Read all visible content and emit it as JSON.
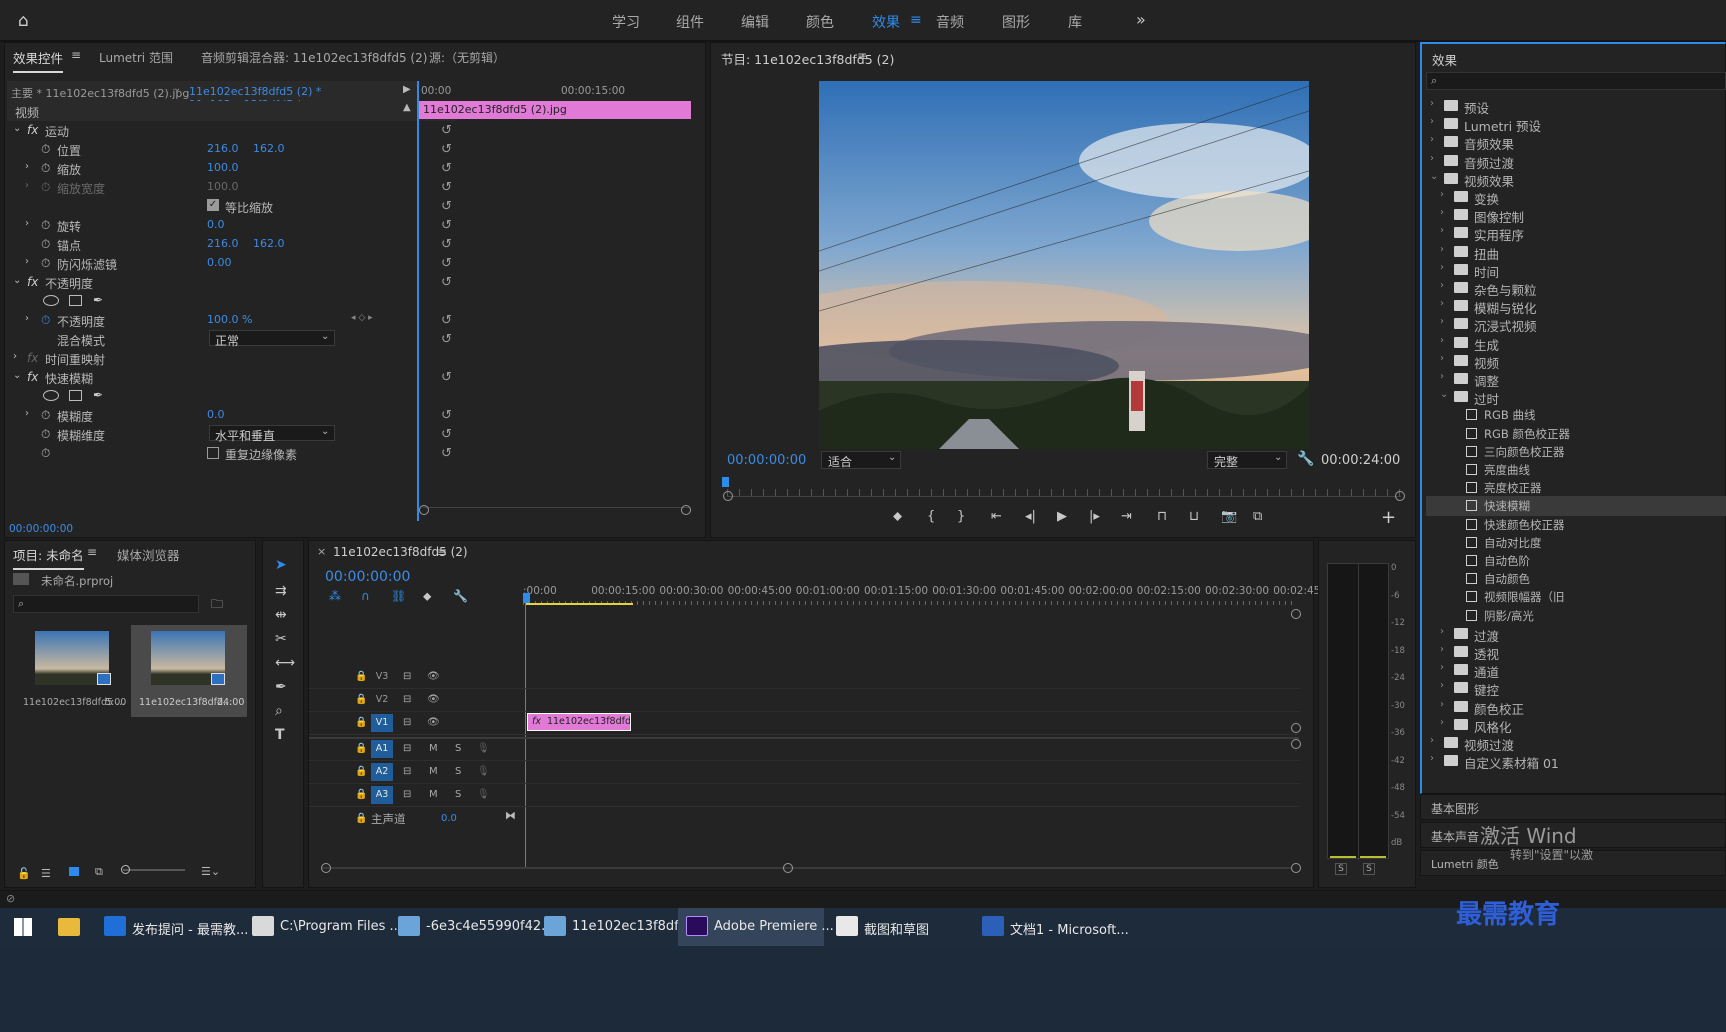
{
  "workspaces": [
    "学习",
    "组件",
    "编辑",
    "颜色",
    "效果",
    "音频",
    "图形",
    "库"
  ],
  "active_workspace": "效果",
  "effect_controls": {
    "tabs": [
      "效果控件",
      "Lumetri 范围",
      "音频剪辑混合器: 11e102ec13f8dfd5 (2)",
      "源:（无剪辑）"
    ],
    "master_label": "主要 * 11e102ec13f8dfd5 (2).jpg",
    "sequence_label": "11e102ec13f8dfd5 (2) * 11e102ec13f8dfd5 (...",
    "ruler_start": "00:00",
    "ruler_mid": "00:00:15:00",
    "clip_name": "11e102ec13f8dfd5 (2).jpg",
    "section_video": "视频",
    "fx_motion": "运动",
    "position_label": "位置",
    "position_x": "216.0",
    "position_y": "162.0",
    "scale_label": "缩放",
    "scale_val": "100.0",
    "scale_width_label": "缩放宽度",
    "scale_width_val": "100.0",
    "uniform_label": "等比缩放",
    "rotation_label": "旋转",
    "rotation_val": "0.0",
    "anchor_label": "锚点",
    "anchor_x": "216.0",
    "anchor_y": "162.0",
    "flicker_label": "防闪烁滤镜",
    "flicker_val": "0.00",
    "fx_opacity": "不透明度",
    "opacity_label": "不透明度",
    "opacity_val": "100.0 %",
    "blend_label": "混合模式",
    "blend_val": "正常",
    "time_remap": "时间重映射",
    "fx_blur": "快速模糊",
    "blur_label": "模糊度",
    "blur_val": "0.0",
    "blur_dim_label": "模糊维度",
    "blur_dim_val": "水平和垂直",
    "repeat_label": "重复边缘像素",
    "timecode": "00:00:00:00"
  },
  "program": {
    "title": "节目: 11e102ec13f8dfd5 (2)",
    "timecode": "00:00:00:00",
    "fit": "适合",
    "quality": "完整",
    "duration": "00:00:24:00"
  },
  "effects_panel": {
    "title": "效果",
    "items": [
      {
        "t": "预设",
        "lv": 0,
        "ic": "folder"
      },
      {
        "t": "Lumetri 预设",
        "lv": 0,
        "ic": "folder"
      },
      {
        "t": "音频效果",
        "lv": 0,
        "ic": "folder"
      },
      {
        "t": "音频过渡",
        "lv": 0,
        "ic": "folder"
      },
      {
        "t": "视频效果",
        "lv": 0,
        "ic": "folder",
        "open": true
      },
      {
        "t": "变换",
        "lv": 1,
        "ic": "folder"
      },
      {
        "t": "图像控制",
        "lv": 1,
        "ic": "folder"
      },
      {
        "t": "实用程序",
        "lv": 1,
        "ic": "folder"
      },
      {
        "t": "扭曲",
        "lv": 1,
        "ic": "folder"
      },
      {
        "t": "时间",
        "lv": 1,
        "ic": "folder"
      },
      {
        "t": "杂色与颗粒",
        "lv": 1,
        "ic": "folder"
      },
      {
        "t": "模糊与锐化",
        "lv": 1,
        "ic": "folder"
      },
      {
        "t": "沉浸式视频",
        "lv": 1,
        "ic": "folder"
      },
      {
        "t": "生成",
        "lv": 1,
        "ic": "folder"
      },
      {
        "t": "视频",
        "lv": 1,
        "ic": "folder"
      },
      {
        "t": "调整",
        "lv": 1,
        "ic": "folder"
      },
      {
        "t": "过时",
        "lv": 1,
        "ic": "folder",
        "open": true
      },
      {
        "t": "RGB 曲线",
        "lv": 2,
        "ic": "fx"
      },
      {
        "t": "RGB 颜色校正器",
        "lv": 2,
        "ic": "fx"
      },
      {
        "t": "三向颜色校正器",
        "lv": 2,
        "ic": "fx"
      },
      {
        "t": "亮度曲线",
        "lv": 2,
        "ic": "fx"
      },
      {
        "t": "亮度校正器",
        "lv": 2,
        "ic": "fx"
      },
      {
        "t": "快速模糊",
        "lv": 2,
        "ic": "fx",
        "sel": true
      },
      {
        "t": "快速颜色校正器",
        "lv": 2,
        "ic": "fx"
      },
      {
        "t": "自动对比度",
        "lv": 2,
        "ic": "fx"
      },
      {
        "t": "自动色阶",
        "lv": 2,
        "ic": "fx"
      },
      {
        "t": "自动颜色",
        "lv": 2,
        "ic": "fx"
      },
      {
        "t": "视频限幅器（旧",
        "lv": 2,
        "ic": "fx"
      },
      {
        "t": "阴影/高光",
        "lv": 2,
        "ic": "fx"
      },
      {
        "t": "过渡",
        "lv": 1,
        "ic": "folder"
      },
      {
        "t": "透视",
        "lv": 1,
        "ic": "folder"
      },
      {
        "t": "通道",
        "lv": 1,
        "ic": "folder"
      },
      {
        "t": "键控",
        "lv": 1,
        "ic": "folder"
      },
      {
        "t": "颜色校正",
        "lv": 1,
        "ic": "folder"
      },
      {
        "t": "风格化",
        "lv": 1,
        "ic": "folder"
      },
      {
        "t": "视频过渡",
        "lv": 0,
        "ic": "folder"
      },
      {
        "t": "自定义素材箱 01",
        "lv": 0,
        "ic": "folder"
      }
    ],
    "bottom": [
      "基本图形",
      "基本声音",
      "Lumetri 颜色"
    ],
    "watermark": "激活 Wind",
    "watermark2": "转到\"设置\"以激"
  },
  "project": {
    "tabs": [
      "项目: 未命名",
      "媒体浏览器"
    ],
    "file": "未命名.prproj",
    "thumbs": [
      {
        "name": "11e102ec13f8dfd5 ...",
        "dur": "5:00"
      },
      {
        "name": "11e102ec13f8dfd...",
        "dur": "24:00"
      }
    ]
  },
  "timeline": {
    "title": "11e102ec13f8dfd5 (2)",
    "timecode": "00:00:00:00",
    "ruler": [
      ":00:00",
      "00:00:15:00",
      "00:00:30:00",
      "00:00:45:00",
      "00:01:00:00",
      "00:01:15:00",
      "00:01:30:00",
      "00:01:45:00",
      "00:02:00:00",
      "00:02:15:00",
      "00:02:30:00",
      "00:02:45:"
    ],
    "tracks": [
      "V3",
      "V2",
      "V1",
      "A1",
      "A2",
      "A3"
    ],
    "master": "主声道",
    "master_val": "0.0",
    "clip": "11e102ec13f8dfd5 ("
  },
  "meter": {
    "ticks": [
      "0",
      "-6",
      "-12",
      "-18",
      "-24",
      "-30",
      "-36",
      "-42",
      "-48",
      "-54",
      "dB"
    ],
    "solo": "S"
  },
  "taskbar": [
    {
      "t": "发布提问 - 最需教...",
      "c": "#1f6fd6"
    },
    {
      "t": "C:\\Program Files ...",
      "c": "#d9d9d9"
    },
    {
      "t": "-6e3c4e55990f42...",
      "c": "#6aa4d9"
    },
    {
      "t": "11e102ec13f8dfd...",
      "c": "#6aa4d9"
    },
    {
      "t": "Adobe Premiere ...",
      "c": "#2a0a5a"
    },
    {
      "t": "截图和草图",
      "c": "#e8e8e8"
    },
    {
      "t": "文档1 - Microsoft...",
      "c": "#2b5fb8"
    }
  ],
  "brand": "最需教育"
}
